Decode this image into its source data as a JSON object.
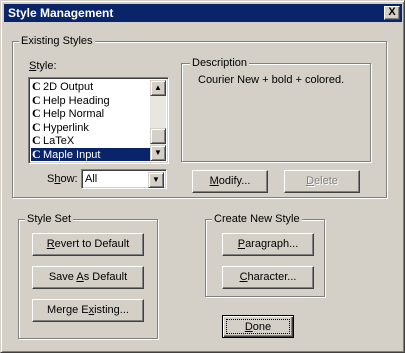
{
  "window": {
    "title": "Style Management",
    "close_glyph": "X"
  },
  "existing_styles": {
    "group_label": "Existing Styles",
    "style_label_mnemonic": "S",
    "style_label_rest": "tyle:",
    "items": [
      {
        "icon": "C",
        "label": "2D Output"
      },
      {
        "icon": "C",
        "label": "Help Heading"
      },
      {
        "icon": "C",
        "label": "Help Normal"
      },
      {
        "icon": "C",
        "label": "Hyperlink"
      },
      {
        "icon": "C",
        "label": "LaTeX"
      },
      {
        "icon": "C",
        "label": "Maple Input"
      }
    ],
    "selected_item": "Maple Input",
    "show_label_before": "S",
    "show_label_mnemonic": "h",
    "show_label_after": "ow:",
    "show_value": "All",
    "description_label": "Description",
    "description_text": "Courier New + bold + colored.",
    "modify_mnemonic": "M",
    "modify_rest": "odify...",
    "delete_mnemonic": "D",
    "delete_rest": "elete"
  },
  "style_set": {
    "group_label": "Style Set",
    "revert_mnemonic": "R",
    "revert_rest": "evert to Default",
    "save_before": "Save ",
    "save_mnemonic": "A",
    "save_after": "s Default",
    "merge_before": "Merge E",
    "merge_mnemonic": "x",
    "merge_after": "isting..."
  },
  "create_new_style": {
    "group_label": "Create New Style",
    "paragraph_mnemonic": "P",
    "paragraph_rest": "aragraph...",
    "character_mnemonic": "C",
    "character_rest": "haracter..."
  },
  "done": {
    "mnemonic": "D",
    "rest": "one"
  },
  "colors": {
    "title_bar": "#0a246a",
    "face": "#d4d0c8",
    "selection": "#0a246a"
  }
}
